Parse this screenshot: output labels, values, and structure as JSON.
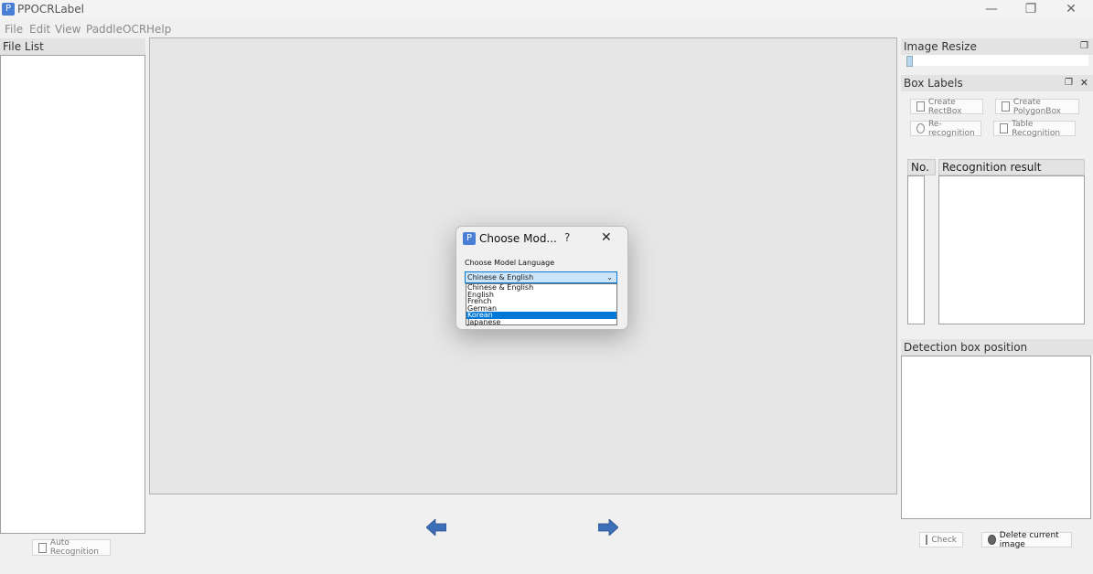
{
  "app": {
    "icon_text": "P",
    "title": "PPOCRLabel"
  },
  "window_controls": {
    "minimize": "—",
    "restore": "❐",
    "close": "✕"
  },
  "menu": [
    "File",
    "Edit",
    "View",
    "PaddleOCR",
    "Help"
  ],
  "file_list": {
    "title": "File List"
  },
  "auto_recognition": {
    "label": "Auto Recognition"
  },
  "image_resize": {
    "title": "Image Resize"
  },
  "box_labels": {
    "title": "Box Labels",
    "buttons": {
      "create_rect": "Create RectBox",
      "create_polygon": "Create PolygonBox",
      "re_recognition": "Re-recognition",
      "table_recognition": "Table Recognition"
    },
    "table_headers": {
      "no": "No.",
      "result": "Recognition result"
    }
  },
  "detection": {
    "title": "Detection box position"
  },
  "bottom_buttons": {
    "check": "Check",
    "delete": "Delete current image"
  },
  "dialog": {
    "icon_text": "P",
    "title": "Choose Mod...",
    "help": "?",
    "close": "✕",
    "label": "Choose Model Language",
    "selected": "Chinese & English",
    "options": [
      "Chinese & English",
      "English",
      "French",
      "German",
      "Korean",
      "Japanese"
    ],
    "highlighted_option": "Korean"
  },
  "colors": {
    "accent": "#0078d7",
    "arrow": "#3d6fb8"
  }
}
